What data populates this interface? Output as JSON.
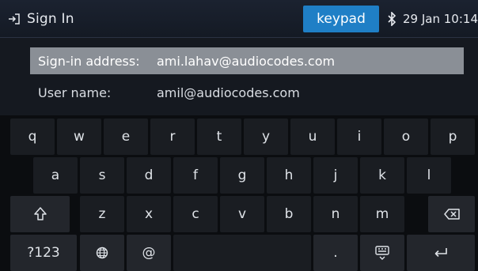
{
  "header": {
    "title": "Sign In",
    "keypad_label": "keypad",
    "datetime": "29 Jan 10:14"
  },
  "fields": {
    "signin_address": {
      "label": "Sign-in address:",
      "value": "ami.lahav@audiocodes.com"
    },
    "user_name": {
      "label": "User name:",
      "value": "amil@audiocodes.com"
    }
  },
  "keyboard": {
    "row1": [
      "q",
      "w",
      "e",
      "r",
      "t",
      "y",
      "u",
      "i",
      "o",
      "p"
    ],
    "row2": [
      "a",
      "s",
      "d",
      "f",
      "g",
      "h",
      "j",
      "k",
      "l"
    ],
    "row3": [
      "z",
      "x",
      "c",
      "v",
      "b",
      "n",
      "m"
    ],
    "mode_label": "?123",
    "at_label": "@",
    "period_label": ".",
    "icons": {
      "shift": "shift-icon",
      "backspace": "backspace-icon",
      "globe": "globe-icon",
      "hide_keyboard": "keyboard-hide-icon",
      "enter": "enter-icon"
    }
  },
  "colors": {
    "accent": "#1f7fc6",
    "active_field": "#8a8f96"
  }
}
